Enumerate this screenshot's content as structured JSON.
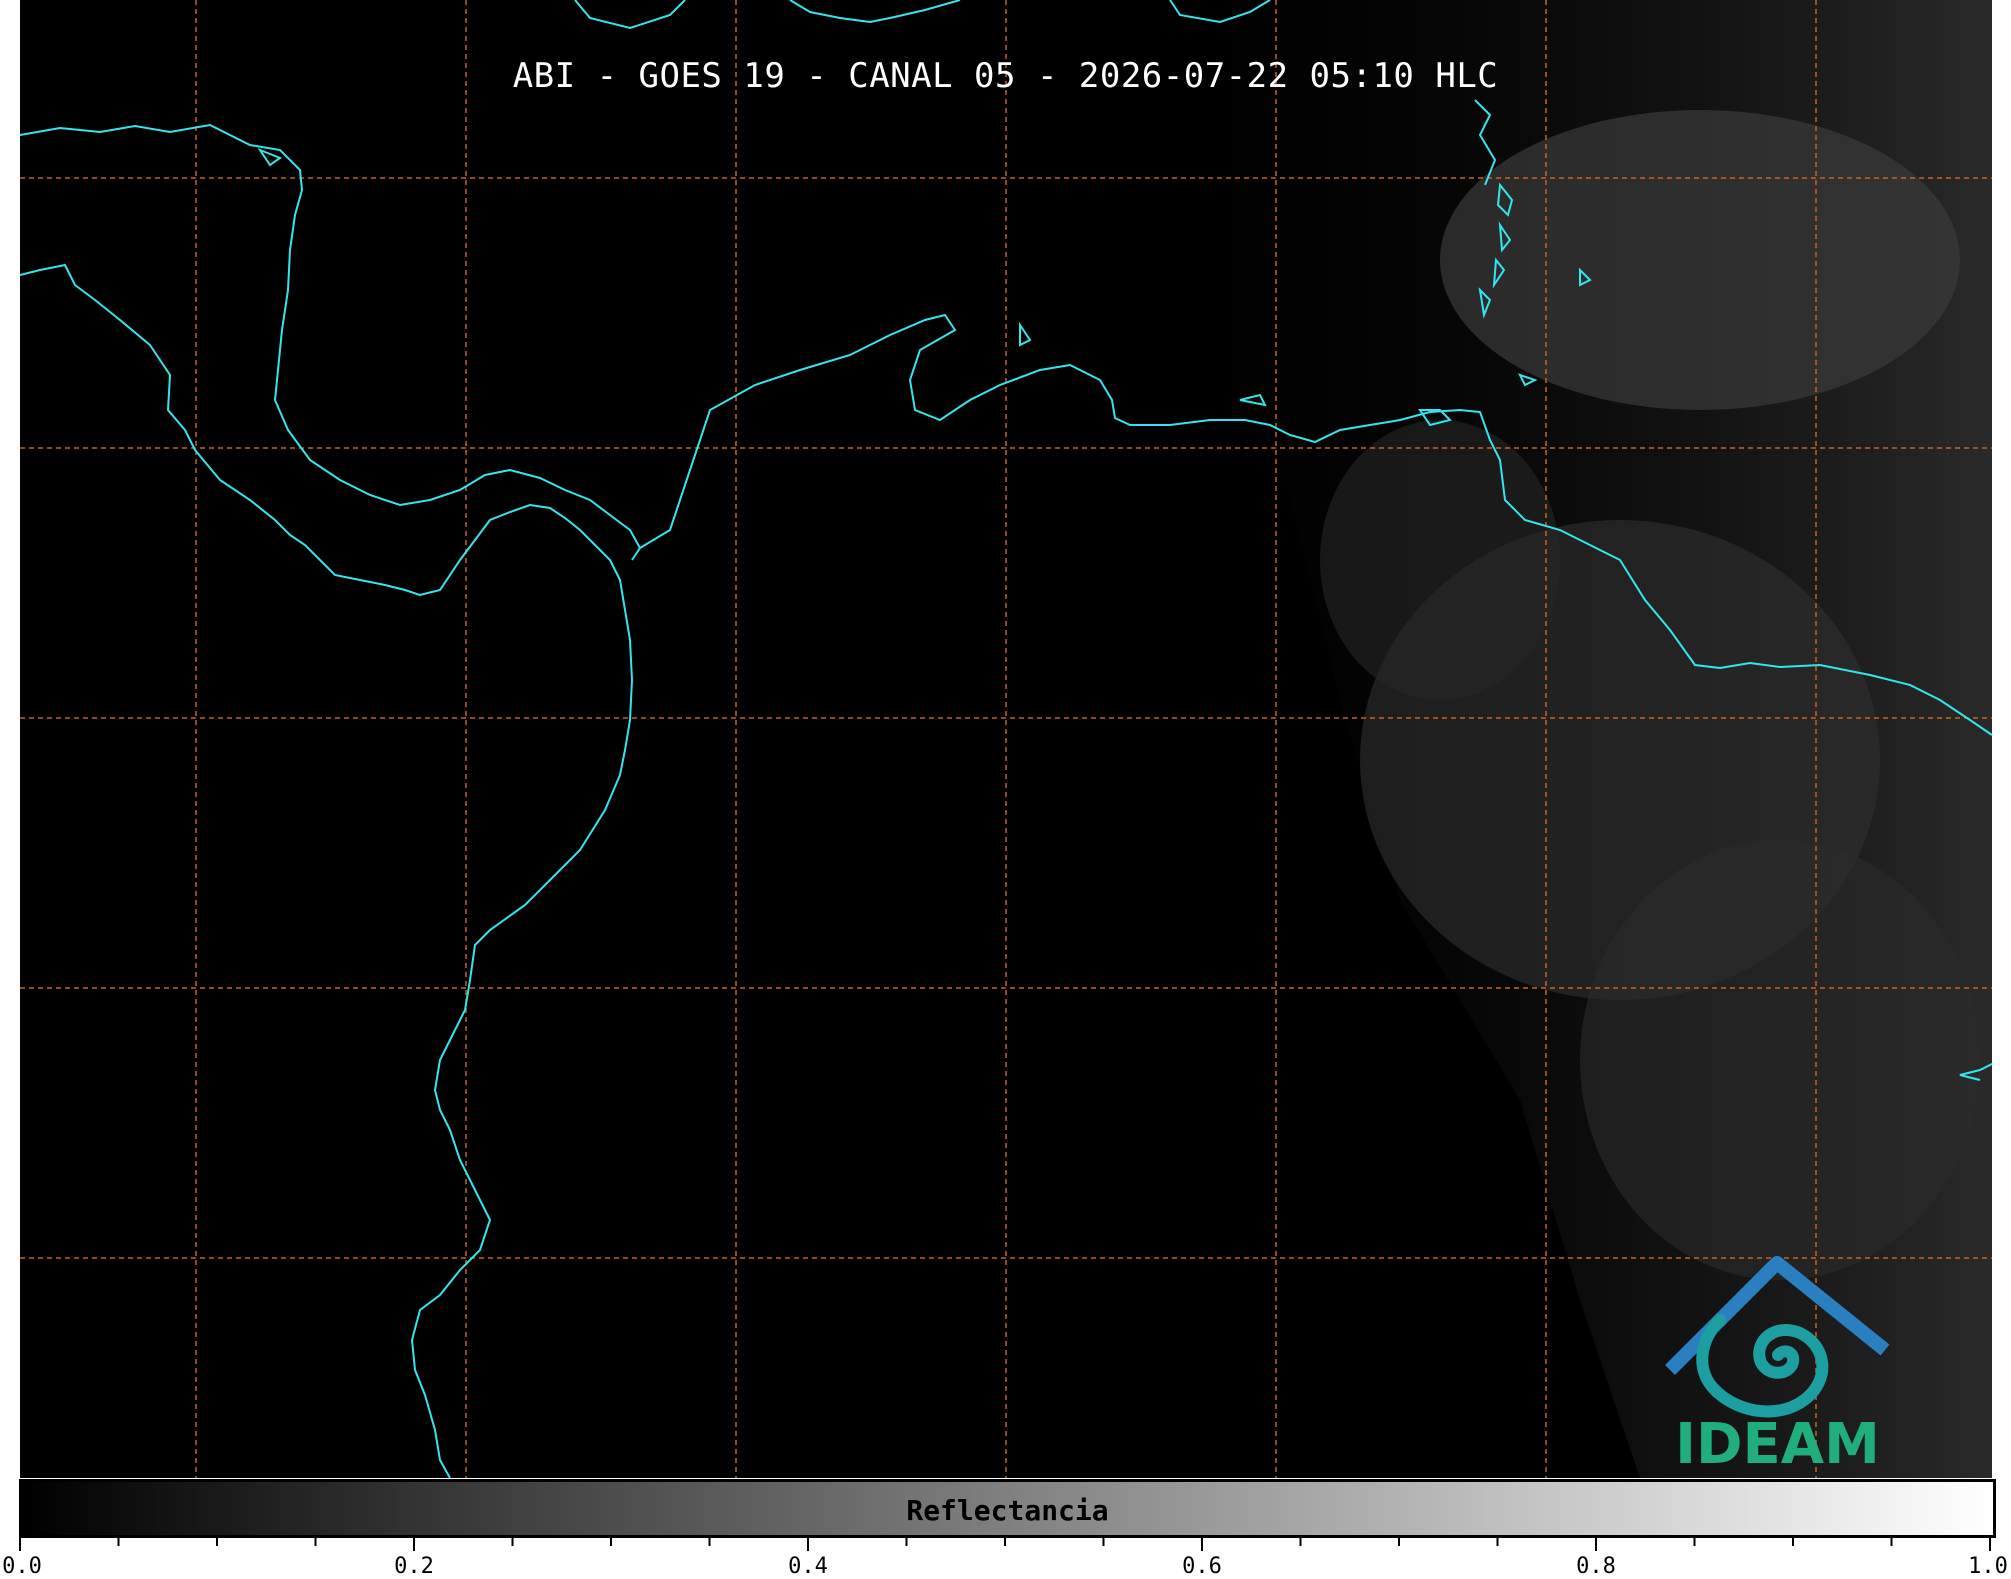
{
  "title": "ABI - GOES 19 - CANAL 05 - 2026-07-22 05:10 HLC",
  "colorbar": {
    "label": "Reflectancia",
    "min": 0.0,
    "max": 1.0,
    "ticks": [
      "0.0",
      "0.2",
      "0.4",
      "0.6",
      "0.8",
      "1.0"
    ],
    "minor_step": 0.05,
    "colors": {
      "start": "#000000",
      "end": "#ffffff"
    }
  },
  "map": {
    "coastline_color": "#33e6ee",
    "gridline_color": "#c8641e",
    "background_color": "#000000"
  },
  "logo": {
    "text": "IDEAM",
    "colors": {
      "top": "#2a7fc0",
      "bottom": "#1fae7c"
    }
  }
}
